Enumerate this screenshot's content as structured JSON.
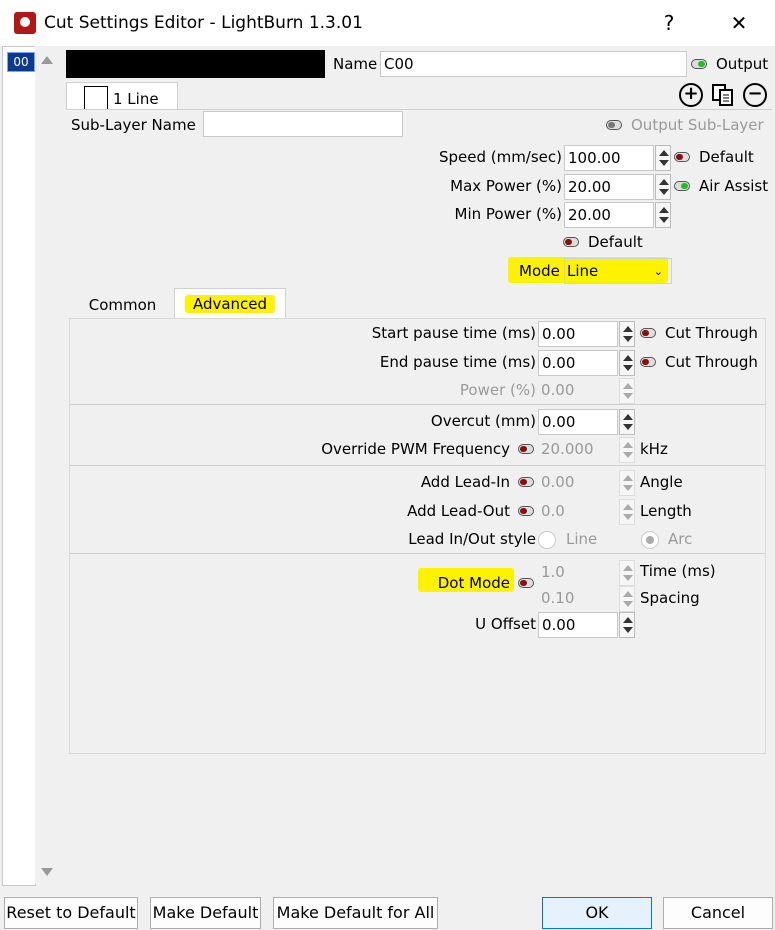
{
  "window": {
    "title": "Cut Settings Editor - LightBurn 1.3.01",
    "help": "?",
    "close": "✕"
  },
  "sidebar": {
    "layer_tag": "00"
  },
  "header": {
    "name_label": "Name",
    "name_value": "C00",
    "output_label": "Output",
    "subtab_label": "1 Line",
    "sublayer_name_label": "Sub-Layer Name",
    "sublayer_name_value": "",
    "output_sublayer_label": "Output Sub-Layer"
  },
  "main": {
    "speed_label": "Speed (mm/sec)",
    "speed_value": "100.00",
    "speed_default_label": "Default",
    "maxpower_label": "Max Power (%)",
    "maxpower_value": "20.00",
    "air_assist_label": "Air Assist",
    "minpower_label": "Min Power (%)",
    "minpower_value": "20.00",
    "default_label": "Default",
    "mode_label": "Mode",
    "mode_value": "Line"
  },
  "tabs": {
    "common": "Common",
    "advanced": "Advanced"
  },
  "advanced": {
    "start_pause_label": "Start pause time (ms)",
    "start_pause_value": "0.00",
    "start_cut_through": "Cut Through",
    "end_pause_label": "End pause time (ms)",
    "end_pause_value": "0.00",
    "end_cut_through": "Cut Through",
    "power_label": "Power (%)",
    "power_value": "0.00",
    "overcut_label": "Overcut (mm)",
    "overcut_value": "0.00",
    "pwm_label": "Override PWM Frequency",
    "pwm_value": "20.000",
    "pwm_unit": "kHz",
    "leadin_label": "Add Lead-In",
    "leadin_value": "0.00",
    "leadin_unit": "Angle",
    "leadout_label": "Add Lead-Out",
    "leadout_value": "0.0",
    "leadout_unit": "Length",
    "leadstyle_label": "Lead In/Out style",
    "leadstyle_opt1": "Line",
    "leadstyle_opt2": "Arc",
    "dotmode_label": "Dot Mode",
    "dot_time_value": "1.0",
    "dot_time_unit": "Time (ms)",
    "dot_spacing_value": "0.10",
    "dot_spacing_unit": "Spacing",
    "uoffset_label": "U Offset",
    "uoffset_value": "0.00"
  },
  "footer": {
    "reset": "Reset to Default",
    "make_default": "Make Default",
    "make_default_all": "Make Default for All",
    "ok": "OK",
    "cancel": "Cancel"
  },
  "colors": {
    "highlight": "#fff200",
    "led_on": "#20c020",
    "led_off": "#8b0d0d",
    "accent": "#0078d4"
  }
}
